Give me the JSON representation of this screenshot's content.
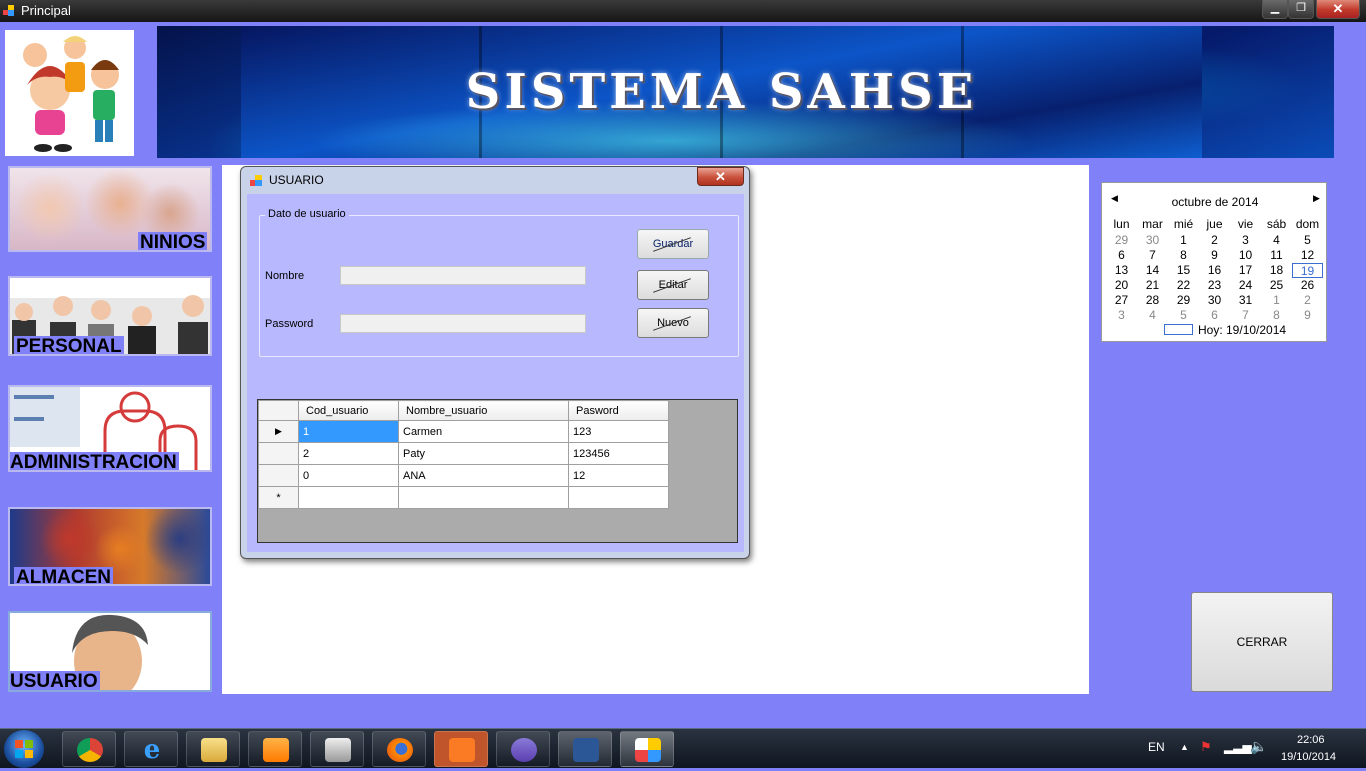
{
  "window": {
    "title": "Principal"
  },
  "banner": {
    "title": "SISTEMA SAHSE"
  },
  "menu": {
    "ninios": "NINIOS",
    "personal": "PERSONAL",
    "administracion": "ADMINISTRACION",
    "almacen": "ALMACEN",
    "usuario": "USUARIO"
  },
  "dialog": {
    "title": "USUARIO",
    "group_title": "Dato de usuario",
    "nombre_label": "Nombre",
    "nombre_value": "",
    "password_label": "Password",
    "password_value": "",
    "buttons": {
      "guardar": "Guardar",
      "editar": "Editar",
      "nuevo": "Nuevo"
    },
    "grid": {
      "columns": [
        "Cod_usuario",
        "Nombre_usuario",
        "Pasword"
      ],
      "rows": [
        {
          "cod": "1",
          "nombre": "Carmen",
          "pass": "123"
        },
        {
          "cod": "2",
          "nombre": "Paty",
          "pass": "123456"
        },
        {
          "cod": "0",
          "nombre": "ANA",
          "pass": "12"
        }
      ],
      "new_row_marker": "*",
      "current_row_marker": "▶"
    }
  },
  "calendar": {
    "month": "octubre de 2014",
    "weekdays": [
      "lun",
      "mar",
      "mié",
      "jue",
      "vie",
      "sáb",
      "dom"
    ],
    "weeks": [
      [
        "29",
        "30",
        "1",
        "2",
        "3",
        "4",
        "5"
      ],
      [
        "6",
        "7",
        "8",
        "9",
        "10",
        "11",
        "12"
      ],
      [
        "13",
        "14",
        "15",
        "16",
        "17",
        "18",
        "19"
      ],
      [
        "20",
        "21",
        "22",
        "23",
        "24",
        "25",
        "26"
      ],
      [
        "27",
        "28",
        "29",
        "30",
        "31",
        "1",
        "2"
      ],
      [
        "3",
        "4",
        "5",
        "6",
        "7",
        "8",
        "9"
      ]
    ],
    "today_label": "Hoy: 19/10/2014",
    "selected": "19"
  },
  "cerrar": "CERRAR",
  "taskbar": {
    "language": "EN",
    "time": "22:06",
    "date": "19/10/2014",
    "apps": [
      "chrome",
      "internet-explorer",
      "file-explorer",
      "media-player",
      "utility",
      "firefox",
      "xampp",
      "visual-studio",
      "word",
      "application"
    ]
  }
}
